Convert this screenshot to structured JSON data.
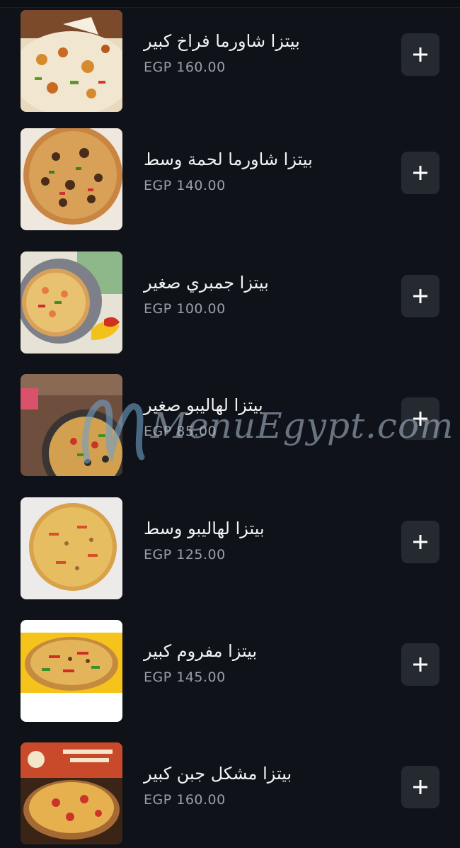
{
  "menu_items": [
    {
      "name": "بيتزا شاورما فراخ كبير",
      "price": "EGP 160.00",
      "image": "chicken-shawarma-pizza-slice"
    },
    {
      "name": "بيتزا شاورما لحمة وسط",
      "price": "EGP 140.00",
      "image": "meat-shawarma-pizza"
    },
    {
      "name": "بيتزا جمبري صغير",
      "price": "EGP 100.00",
      "image": "shrimp-pizza"
    },
    {
      "name": "بيتزا لهاليبو صغير",
      "price": "EGP 85.00",
      "image": "halibo-pizza-small"
    },
    {
      "name": "بيتزا لهاليبو وسط",
      "price": "EGP 125.00",
      "image": "halibo-pizza-medium"
    },
    {
      "name": "بيتزا مفروم كبير",
      "price": "EGP 145.00",
      "image": "minced-meat-pizza"
    },
    {
      "name": "بيتزا مشكل جبن كبير",
      "price": "EGP 160.00",
      "image": "mixed-cheese-pizza"
    }
  ],
  "add_button_icon": "plus-icon",
  "watermark": {
    "text": "MenuEgypt.com"
  },
  "colors": {
    "background": "#0f1218",
    "button_bg": "#252a31",
    "name_text": "#f2f3f5",
    "price_text": "#9aa0a8"
  }
}
